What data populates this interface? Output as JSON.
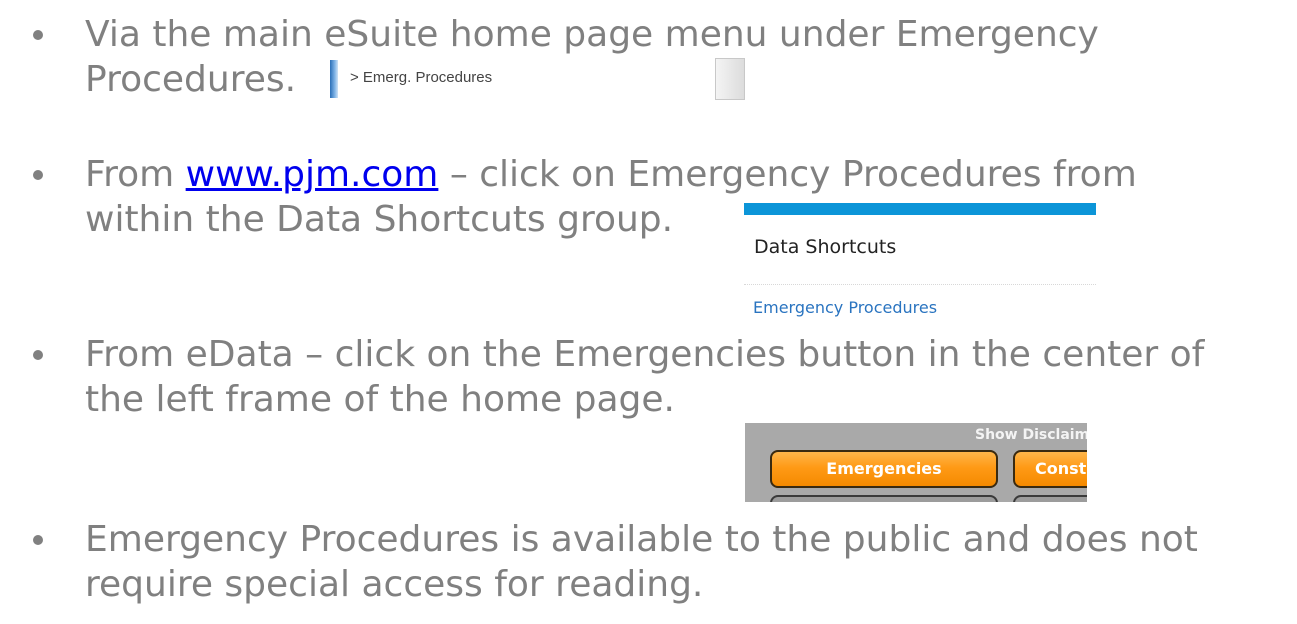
{
  "bullets": [
    {
      "line1": "Via the main eSuite home page menu under Emergency",
      "line2": "Procedures."
    },
    {
      "line1_prefix": "From ",
      "line1_link": "www.pjm.com",
      "line1_suffix": " – click on Emergency Procedures from",
      "line2": "within the Data Shortcuts group."
    },
    {
      "line1": "From eData – click on the Emergencies button in the center of",
      "line2": "the left frame of the home page."
    },
    {
      "line1": "Emergency Procedures is available to the public and does not",
      "line2": "require special access for reading."
    }
  ],
  "esuite_menu": {
    "item_label": "> Emerg. Procedures"
  },
  "data_shortcuts": {
    "title": "Data Shortcuts",
    "link_label": "Emergency Procedures",
    "accent_color": "#0c95d8"
  },
  "edata_frame": {
    "disclaimer_label": "Show Disclaimer",
    "emergencies_label": "Emergencies",
    "const_label": "Const",
    "button_color": "#ff9a16"
  }
}
